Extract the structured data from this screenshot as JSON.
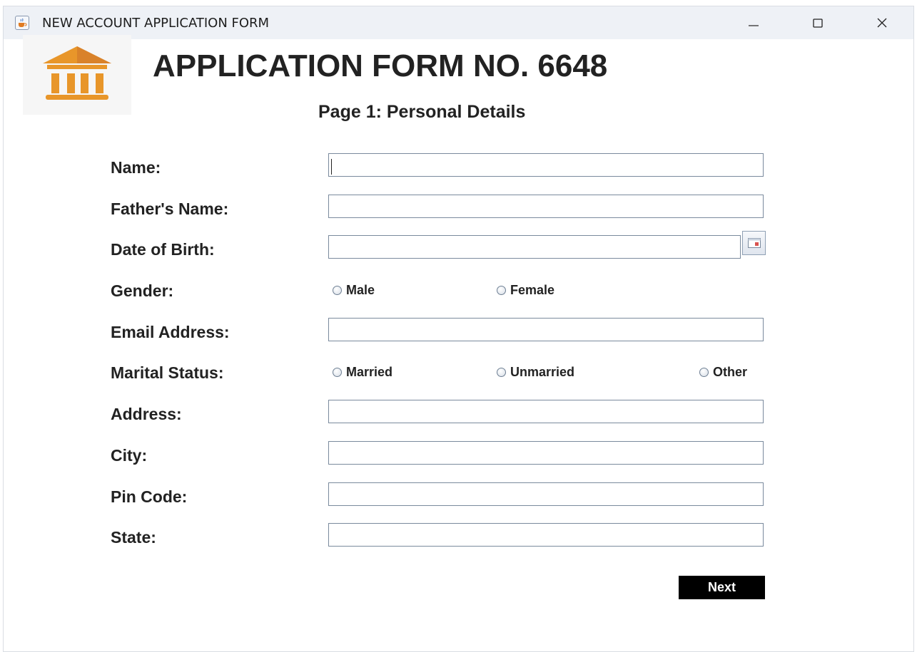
{
  "window": {
    "title": "NEW ACCOUNT APPLICATION FORM",
    "icon": "java-cup-icon",
    "controls": [
      "minimize-icon",
      "maximize-icon",
      "close-icon"
    ]
  },
  "header": {
    "logo_icon": "bank-building-icon",
    "logo_color": "#e8962a",
    "title": "APPLICATION FORM NO. 6648",
    "subtitle": "Page 1: Personal Details"
  },
  "form": {
    "name_label": "Name:",
    "name_value": "",
    "father_name_label": "Father's Name:",
    "father_name_value": "",
    "dob_label": "Date of Birth:",
    "dob_value": "",
    "dob_picker_icon": "calendar-icon",
    "gender_label": "Gender:",
    "gender_options": [
      "Male",
      "Female"
    ],
    "email_label": "Email Address:",
    "email_value": "",
    "marital_label": "Marital Status:",
    "marital_options": [
      "Married",
      "Unmarried",
      "Other"
    ],
    "address_label": "Address:",
    "address_value": "",
    "city_label": "City:",
    "city_value": "",
    "pin_label": "Pin Code:",
    "pin_value": "",
    "state_label": "State:",
    "state_value": ""
  },
  "actions": {
    "next_label": "Next"
  }
}
